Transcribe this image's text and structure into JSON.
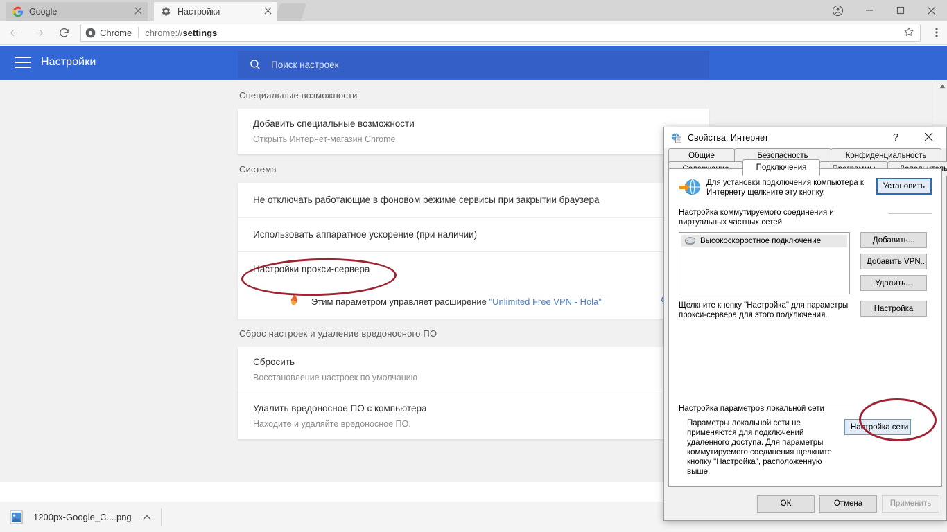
{
  "browser": {
    "tabs": [
      {
        "title": "Google",
        "favicon": "google-icon",
        "active": false
      },
      {
        "title": "Настройки",
        "favicon": "gear-icon",
        "active": true
      }
    ],
    "window_controls": {
      "profile": "profile-icon",
      "minimize": "minimize-icon",
      "maximize": "maximize-icon",
      "close": "close-icon"
    },
    "toolbar": {
      "back": "back-arrow-icon",
      "forward": "forward-arrow-icon",
      "reload": "reload-icon",
      "scheme_chip": "Chrome",
      "url_prefix": "chrome://",
      "url_path": "settings",
      "url_full": "chrome://settings",
      "bookmark": "star-icon",
      "menu": "three-dots-icon"
    }
  },
  "settings_header": {
    "menu_icon": "hamburger-icon",
    "title": "Настройки",
    "search_icon": "search-icon",
    "search_placeholder": "Поиск настроек",
    "search_value": "",
    "bg_color": "#3367d6"
  },
  "settings": {
    "sections": [
      {
        "title": "Специальные возможности",
        "rows": [
          {
            "title": "Добавить специальные возможности",
            "sub": "Открыть Интернет-магазин Chrome",
            "trailing_icon": "external-link-icon"
          }
        ]
      },
      {
        "title": "Система",
        "rows": [
          {
            "title": "Не отключать работающие в фоновом режиме сервисы при закрытии браузера",
            "sub": "",
            "trailing_icon": "toggle-switch"
          },
          {
            "title": "Использовать аппаратное ускорение (при наличии)",
            "sub": "",
            "trailing_icon": "toggle-switch"
          },
          {
            "title": "Настройки прокси-сервера",
            "sub": "",
            "trailing_icon": "external-link-icon",
            "highlighted": true
          }
        ],
        "extension_notice": {
          "icon": "flame-icon",
          "text_before": "Этим параметром управляет расширение ",
          "link_text": "\"Unlimited Free VPN - Hola\"",
          "disable_label": "ОТКЛЮ",
          "link_color": "#4b7fd6"
        }
      },
      {
        "title": "Сброс настроек и удаление вредоносного ПО",
        "rows": [
          {
            "title": "Сбросить",
            "sub": "Восстановление настроек по умолчанию",
            "trailing_icon": ""
          },
          {
            "title": "Удалить вредоносное ПО с компьютера",
            "sub": "Находите и удаляйте вредоносное ПО.",
            "trailing_icon": ""
          }
        ]
      }
    ],
    "scrollbar": {
      "up_arrow": "scroll-up-arrow-icon",
      "down_arrow": "scroll-down-arrow-icon"
    }
  },
  "download_shelf": {
    "item": {
      "icon": "image-file-icon",
      "filename": "1200px-Google_C....png",
      "menu": "chevron-up-icon"
    }
  },
  "dialog": {
    "icon": "internet-properties-icon",
    "title": "Свойства: Интернет",
    "help_label": "?",
    "close_label": "✕",
    "tabs_row1": [
      {
        "label": "Общие",
        "selected": false
      },
      {
        "label": "Безопасность",
        "selected": false
      },
      {
        "label": "Конфиденциальность",
        "selected": false
      }
    ],
    "tabs_row2": [
      {
        "label": "Содержание",
        "selected": false
      },
      {
        "label": "Подключения",
        "selected": true
      },
      {
        "label": "Программы",
        "selected": false
      },
      {
        "label": "Дополнительно",
        "selected": false
      }
    ],
    "connections": {
      "intro_icon": "globe-with-arrow-icon",
      "intro_text": "Для установки подключения компьютера к Интернету щелкните эту кнопку.",
      "setup_button": "Установить",
      "dialup_group_label": "Настройка коммутируемого соединения и виртуальных частных сетей",
      "list_items": [
        {
          "icon": "modem-icon",
          "label": "Высокоскоростное подключение"
        }
      ],
      "side_buttons": [
        {
          "label": "Добавить..."
        },
        {
          "label": "Добавить VPN..."
        },
        {
          "label": "Удалить..."
        },
        {
          "label": "Настройка"
        }
      ],
      "proxy_hint": "Щелкните кнопку \"Настройка\" для параметры прокси-сервера для этого подключения.",
      "lan_group_label": "Настройка параметров локальной сети",
      "lan_hint": "Параметры локальной сети не применяются для подключений удаленного доступа. Для параметры коммутируемого соединения щелкните кнопку \"Настройка\", расположенную выше.",
      "lan_button": "Настройка сети",
      "lan_button_highlighted": true
    },
    "footer": {
      "ok": "ОК",
      "cancel": "Отмена",
      "apply": "Применить",
      "apply_disabled": true
    }
  },
  "annotations": {
    "color": "#9c2434",
    "ovals": [
      {
        "name": "proxy-settings-oval"
      },
      {
        "name": "lan-settings-oval"
      }
    ]
  }
}
